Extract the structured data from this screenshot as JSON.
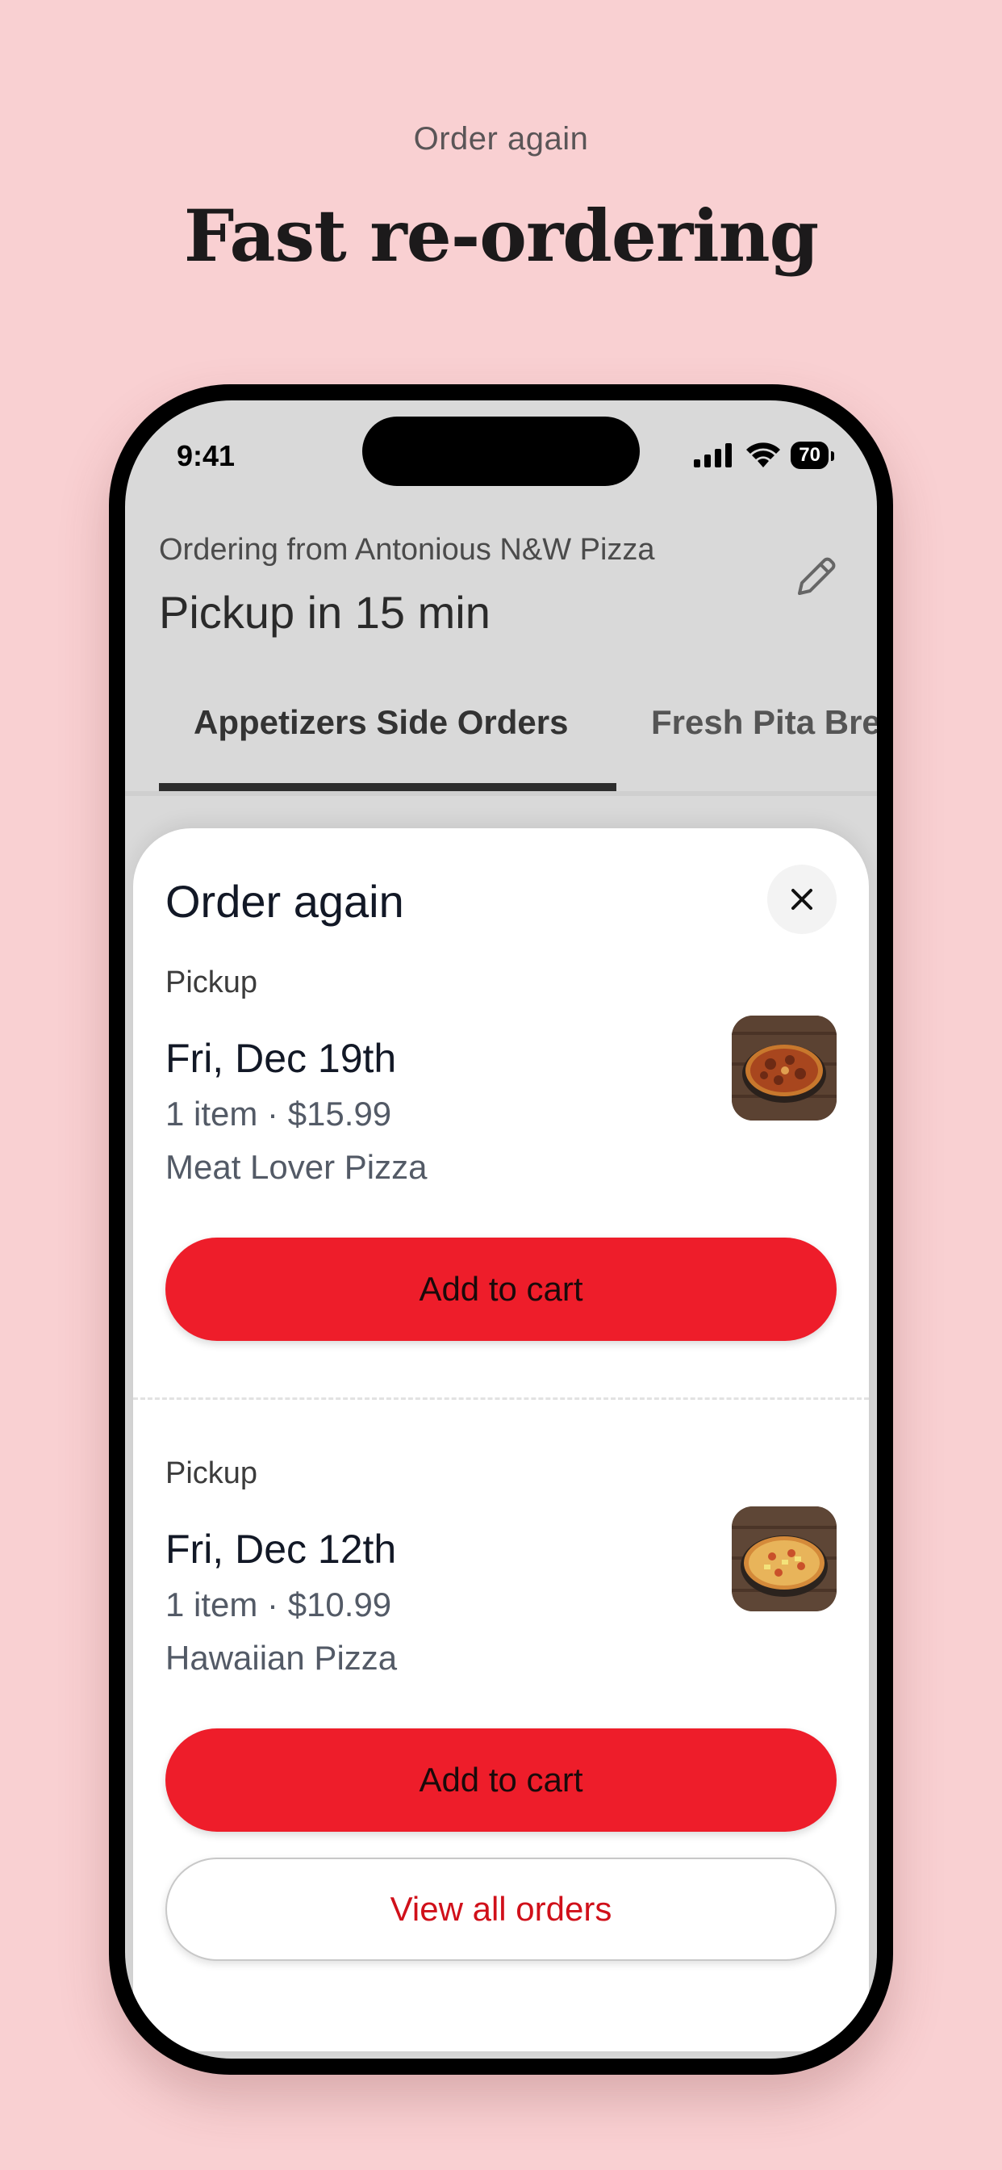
{
  "hero": {
    "kicker": "Order again",
    "title": "Fast re-ordering"
  },
  "status_bar": {
    "time": "9:41",
    "battery": "70",
    "icons": [
      "signal-icon",
      "wifi-icon",
      "battery-icon"
    ]
  },
  "header": {
    "ordering_from": "Ordering from Antonious N&W Pizza",
    "pickup_time": "Pickup in 15 min",
    "edit_icon": "pencil-icon"
  },
  "tabs": [
    {
      "label": "Appetizers Side Orders",
      "active": true
    },
    {
      "label": "Fresh Pita Bre",
      "active": false
    }
  ],
  "sheet": {
    "title": "Order again",
    "close_icon": "close-icon",
    "orders": [
      {
        "label": "Pickup",
        "date": "Fri, Dec 19th",
        "summary": "1 item · $15.99",
        "item": "Meat Lover Pizza",
        "button": "Add to cart",
        "image": "pizza-thumbnail"
      },
      {
        "label": "Pickup",
        "date": "Fri, Dec 12th",
        "summary": "1 item · $10.99",
        "item": "Hawaiian Pizza",
        "button": "Add to cart",
        "image": "pizza-thumbnail"
      }
    ],
    "view_all": "View all orders"
  },
  "colors": {
    "background": "#f9d0d2",
    "accent": "#ee1d2a",
    "link": "#d0101a"
  }
}
